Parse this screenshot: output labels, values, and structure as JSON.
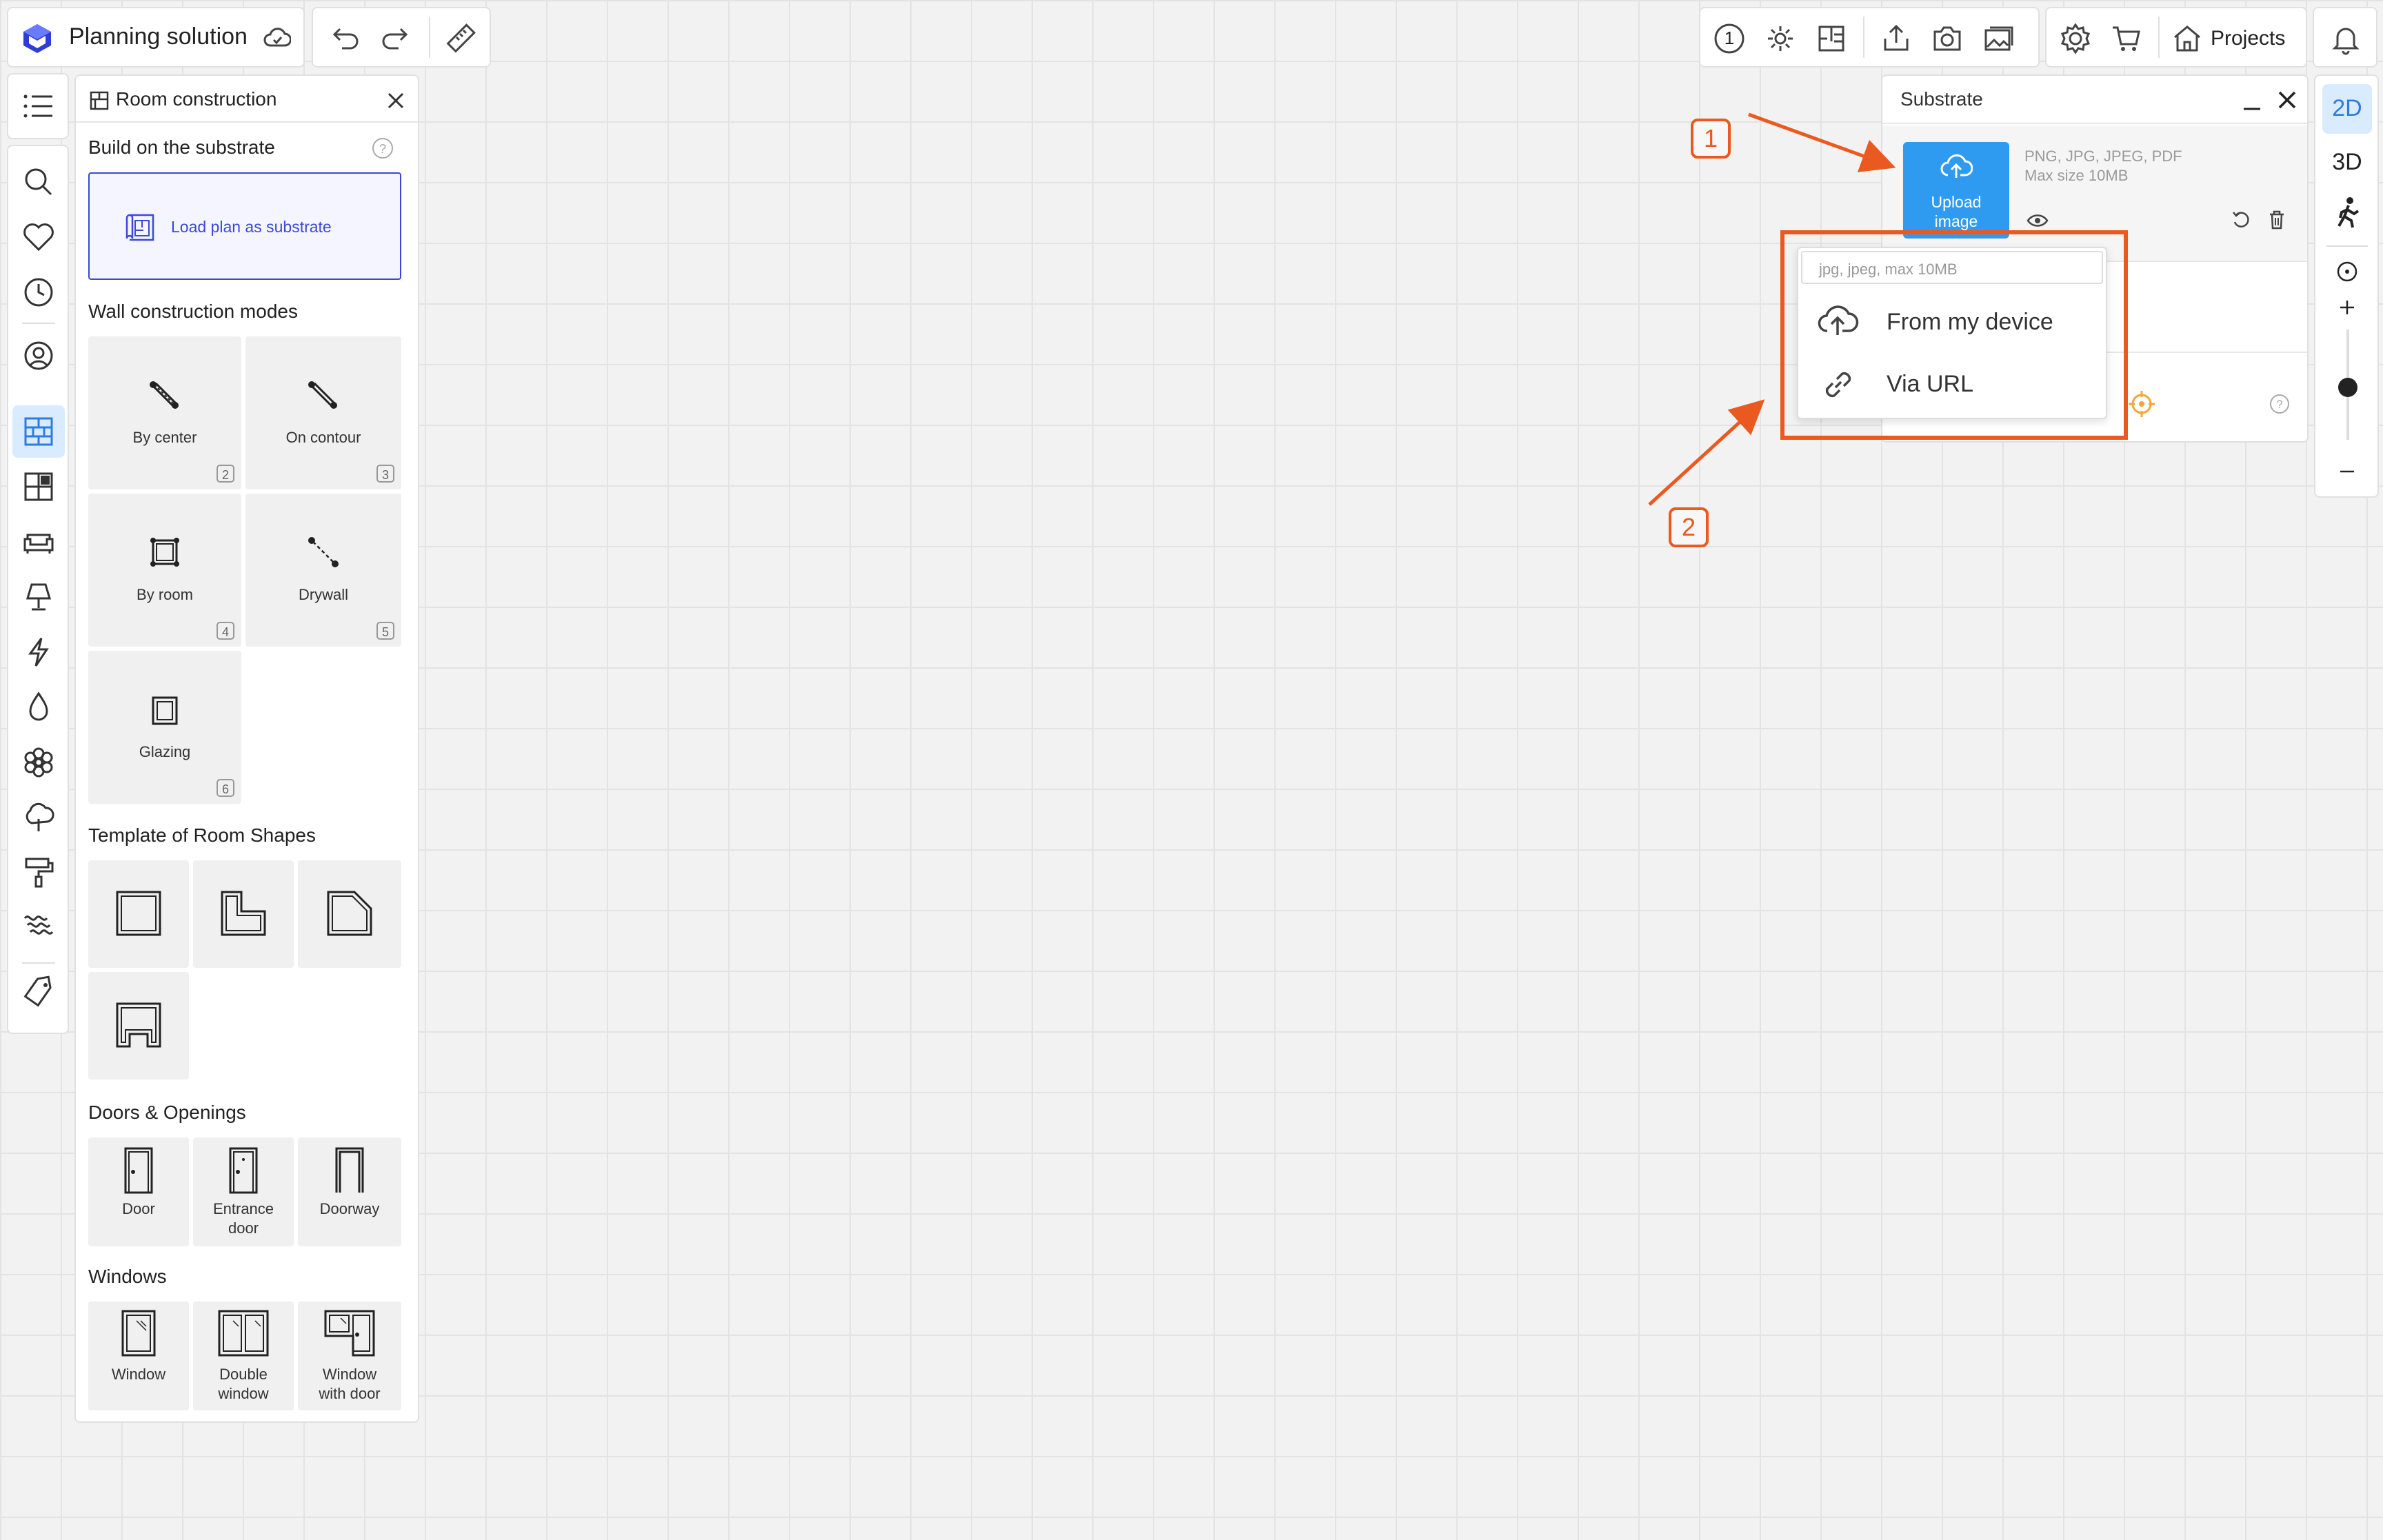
{
  "app": {
    "title": "Planning solution"
  },
  "topbar": {
    "level_number": "1",
    "projects_label": "Projects"
  },
  "room_panel": {
    "title": "Room construction",
    "build_on_substrate": "Build on the substrate",
    "load_plan_label": "Load plan as substrate",
    "wall_modes_title": "Wall construction modes",
    "modes": [
      {
        "label": "By center",
        "key": "2"
      },
      {
        "label": "On contour",
        "key": "3"
      },
      {
        "label": "By room",
        "key": "4"
      },
      {
        "label": "Drywall",
        "key": "5"
      },
      {
        "label": "Glazing",
        "key": "6"
      }
    ],
    "templates_title": "Template of Room Shapes",
    "doors_title": "Doors & Openings",
    "doors": [
      {
        "label_line1": "Door",
        "label_line2": ""
      },
      {
        "label_line1": "Entrance",
        "label_line2": "door"
      },
      {
        "label_line1": "Doorway",
        "label_line2": ""
      }
    ],
    "windows_title": "Windows",
    "windows": [
      {
        "label_line1": "Window",
        "label_line2": ""
      },
      {
        "label_line1": "Double",
        "label_line2": "window"
      },
      {
        "label_line1": "Window",
        "label_line2": "with door"
      }
    ]
  },
  "substrate": {
    "title": "Substrate",
    "upload_line1": "Upload",
    "upload_line2": "image",
    "formats": "PNG, JPG, JPEG, PDF",
    "max_size": "Max size 10MB"
  },
  "upload_menu": {
    "hint": "jpg, jpeg, max 10MB",
    "from_device": "From my device",
    "via_url": "Via URL"
  },
  "view_toggle": {
    "mode_2d": "2D",
    "mode_3d": "3D"
  },
  "annotations": {
    "one": "1",
    "two": "2"
  },
  "colors": {
    "accent": "#2d3dd6",
    "upload_blue": "#2e9bf0",
    "annotation": "#ea5a20",
    "selected_bg": "#d9ebff"
  }
}
